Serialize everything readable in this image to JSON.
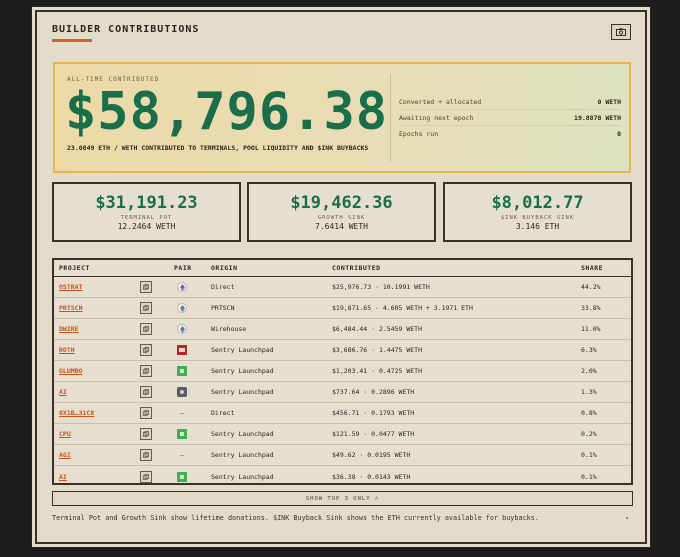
{
  "header": {
    "title": "BUILDER CONTRIBUTIONS",
    "camera_icon": "camera-icon"
  },
  "hero": {
    "label": "ALL-TIME CONTRIBUTED",
    "amount": "$58,796.38",
    "subtitle": "23.0849 ETH / WETH CONTRIBUTED TO TERMINALS, POOL LIQUIDITY AND $INK BUYBACKS",
    "stats": [
      {
        "key": "Converted + allocated",
        "value": "0 WETH"
      },
      {
        "key": "Awaiting next epoch",
        "value": "19.8878 WETH"
      },
      {
        "key": "Epochs run",
        "value": "0"
      }
    ]
  },
  "cards": [
    {
      "amount": "$31,191.23",
      "label": "TERMINAL POT",
      "sub": "12.2464 WETH"
    },
    {
      "amount": "$19,462.36",
      "label": "GROWTH SINK",
      "sub": "7.6414 WETH"
    },
    {
      "amount": "$8,012.77",
      "label": "$INK BUYBACK SINK",
      "sub": "3.146 ETH"
    }
  ],
  "table": {
    "headers": {
      "project": "PROJECT",
      "pair": "PAIR",
      "origin": "ORIGIN",
      "contributed": "CONTRIBUTED",
      "share": "SHARE"
    },
    "rows": [
      {
        "project": "OSTRAT",
        "pair_icon": "eth",
        "origin": "Direct",
        "contributed": "$25,976.73 · 10.1991 WETH",
        "share": "44.2%"
      },
      {
        "project": "PRTSCN",
        "pair_icon": "eth",
        "origin": "PRTSCN",
        "contributed": "$19,871.65 · 4.605 WETH + 3.1971 ETH",
        "share": "33.8%"
      },
      {
        "project": "DWIRE",
        "pair_icon": "eth",
        "origin": "Wirehouse",
        "contributed": "$6,484.44 · 2.5459 WETH",
        "share": "11.0%"
      },
      {
        "project": "ROTH",
        "pair_icon": "red",
        "origin": "Sentry Launchpad",
        "contributed": "$3,686.76 · 1.4475 WETH",
        "share": "6.3%"
      },
      {
        "project": "GLUMBO",
        "pair_icon": "green",
        "origin": "Sentry Launchpad",
        "contributed": "$1,203.41 · 0.4725 WETH",
        "share": "2.0%"
      },
      {
        "project": "AI",
        "pair_icon": "gray",
        "origin": "Sentry Launchpad",
        "contributed": "$737.64 · 0.2896 WETH",
        "share": "1.3%"
      },
      {
        "project": "0X1B…31C8",
        "pair_icon": "dash",
        "origin": "Direct",
        "contributed": "$456.71 · 0.1793 WETH",
        "share": "0.8%"
      },
      {
        "project": "CPU",
        "pair_icon": "green",
        "origin": "Sentry Launchpad",
        "contributed": "$121.59 · 0.0477 WETH",
        "share": "0.2%"
      },
      {
        "project": "AGI",
        "pair_icon": "dash",
        "origin": "Sentry Launchpad",
        "contributed": "$49.62 · 0.0195 WETH",
        "share": "0.1%"
      },
      {
        "project": "AI",
        "pair_icon": "green",
        "origin": "Sentry Launchpad",
        "contributed": "$36.38 · 0.0143 WETH",
        "share": "0.1%"
      }
    ]
  },
  "toggle_label": "SHOW TOP 3 ONLY ˄",
  "footnote": "Terminal Pot and Growth Sink show lifetime donations. $INK Buyback Sink shows the ETH currently available for buybacks.",
  "colors": {
    "accent": "#d4622a",
    "green": "#1a6f4a",
    "panel": "#e4dccb",
    "hero_border": "#e6b64d"
  }
}
